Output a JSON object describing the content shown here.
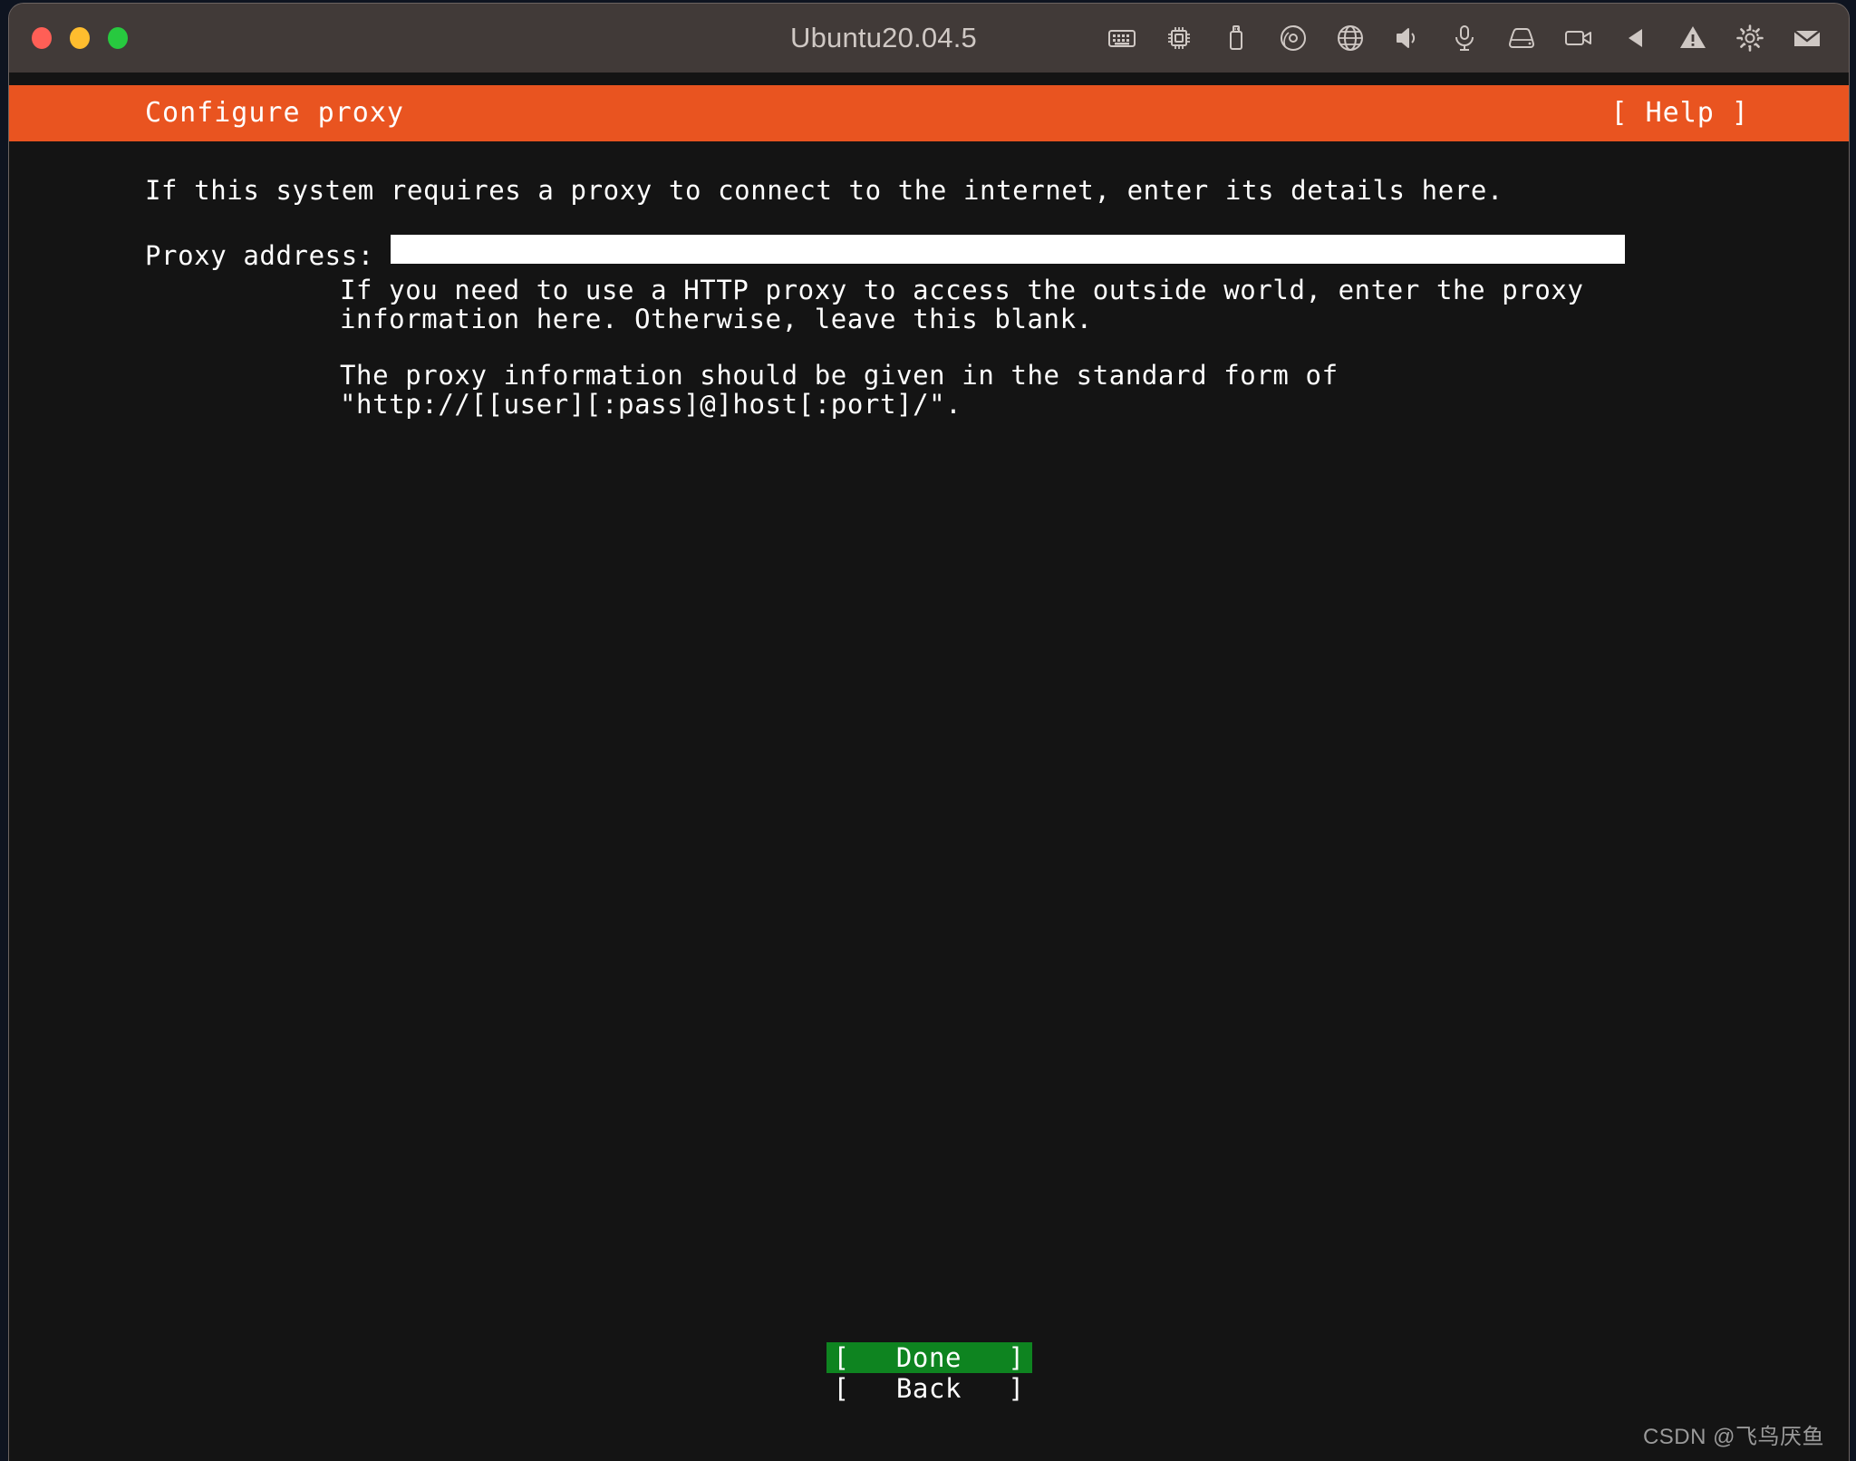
{
  "window": {
    "title": "Ubuntu20.04.5",
    "traffic_lights": [
      "close",
      "minimize",
      "maximize"
    ],
    "toolbar_icons": [
      "keyboard-icon",
      "cpu-icon",
      "usb-drive-icon",
      "optical-disc-icon",
      "network-globe-icon",
      "speaker-icon",
      "microphone-icon",
      "hard-drive-icon",
      "video-camera-icon",
      "play-back-icon",
      "warning-icon",
      "gear-icon",
      "mail-icon"
    ]
  },
  "header": {
    "title": "Configure proxy",
    "help_label": "[ Help ]",
    "accent_color": "#e95420"
  },
  "content": {
    "intro": "If this system requires a proxy to connect to the internet, enter its details here.",
    "proxy_label": "Proxy address:",
    "proxy_value": "",
    "proxy_placeholder": "",
    "help_paragraph_1_line_1": "If you need to use a HTTP proxy to access the outside world, enter the proxy",
    "help_paragraph_1_line_2": "information here. Otherwise, leave this blank.",
    "help_paragraph_2_line_1": "The proxy information should be given in the standard form of",
    "help_paragraph_2_line_2": "\"http://[[user][:pass]@]host[:port]/\"."
  },
  "buttons": {
    "done": {
      "label": "Done",
      "open": "[",
      "close": "]",
      "selected": true,
      "highlight_color": "#0e8420"
    },
    "back": {
      "label": "Back",
      "open": "[",
      "close": "]",
      "selected": false
    }
  },
  "watermark": "CSDN @飞鸟厌鱼"
}
